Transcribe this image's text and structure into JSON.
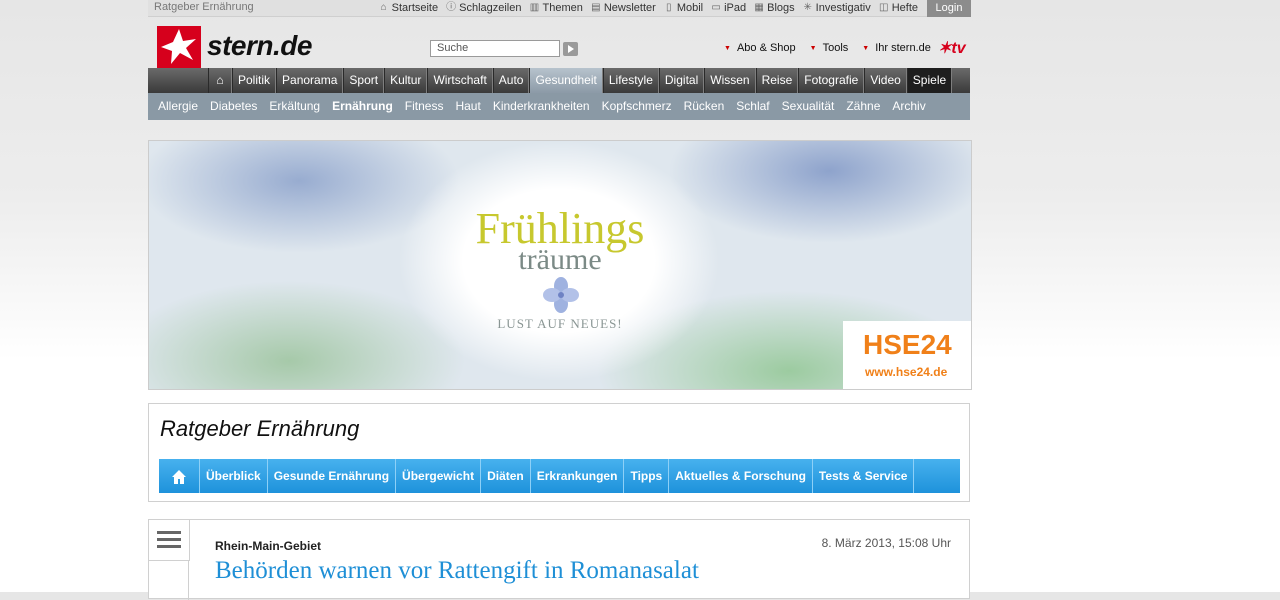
{
  "topbar": {
    "page_name": "Ratgeber Ernährung",
    "links": [
      {
        "label": "Startseite",
        "icon": "home-line-icon"
      },
      {
        "label": "Schlagzeilen",
        "icon": "info-icon"
      },
      {
        "label": "Themen",
        "icon": "book-icon"
      },
      {
        "label": "Newsletter",
        "icon": "document-icon"
      },
      {
        "label": "Mobil",
        "icon": "phone-icon"
      },
      {
        "label": "iPad",
        "icon": "tablet-icon"
      },
      {
        "label": "Blogs",
        "icon": "blog-icon"
      },
      {
        "label": "Investigativ",
        "icon": "star-icon"
      },
      {
        "label": "Hefte",
        "icon": "magazine-icon"
      }
    ],
    "login_label": "Login"
  },
  "header": {
    "logo_text": "stern.de",
    "search_placeholder": "Suche",
    "links": [
      "Abo & Shop",
      "Tools",
      "Ihr stern.de"
    ],
    "tv_logo": "tv"
  },
  "main_nav": {
    "items": [
      "Politik",
      "Panorama",
      "Sport",
      "Kultur",
      "Wirtschaft",
      "Auto",
      "Gesundheit",
      "Lifestyle",
      "Digital",
      "Wissen",
      "Reise",
      "Fotografie",
      "Video",
      "Spiele"
    ],
    "active": "Gesundheit"
  },
  "sub_nav": {
    "items": [
      "Allergie",
      "Diabetes",
      "Erkältung",
      "Ernährung",
      "Fitness",
      "Haut",
      "Kinderkrankheiten",
      "Kopfschmerz",
      "Rücken",
      "Schlaf",
      "Sexualität",
      "Zähne",
      "Archiv"
    ],
    "active": "Ernährung"
  },
  "banner": {
    "line1": "Frühlings",
    "line2": "träume",
    "line3": "LUST AUF NEUES!",
    "brand": "HSE24",
    "brand_url": "www.hse24.de"
  },
  "ratgeber": {
    "title": "Ratgeber Ernährung",
    "nav": [
      "Überblick",
      "Gesunde Ernährung",
      "Übergewicht",
      "Diäten",
      "Erkrankungen",
      "Tipps",
      "Aktuelles & Forschung",
      "Tests & Service"
    ]
  },
  "article": {
    "kicker": "Rhein-Main-Gebiet",
    "date": "8. März 2013, 15:08 Uhr",
    "headline": "Behörden warnen vor Rattengift in Romanasalat"
  },
  "colors": {
    "brand_red": "#d6001c",
    "nav_dark": "#3a3a3a",
    "subnav": "#8a99a5",
    "ratgeber_blue": "#1e92db",
    "headline_blue": "#1e8fd6",
    "hse_orange": "#f08019"
  }
}
